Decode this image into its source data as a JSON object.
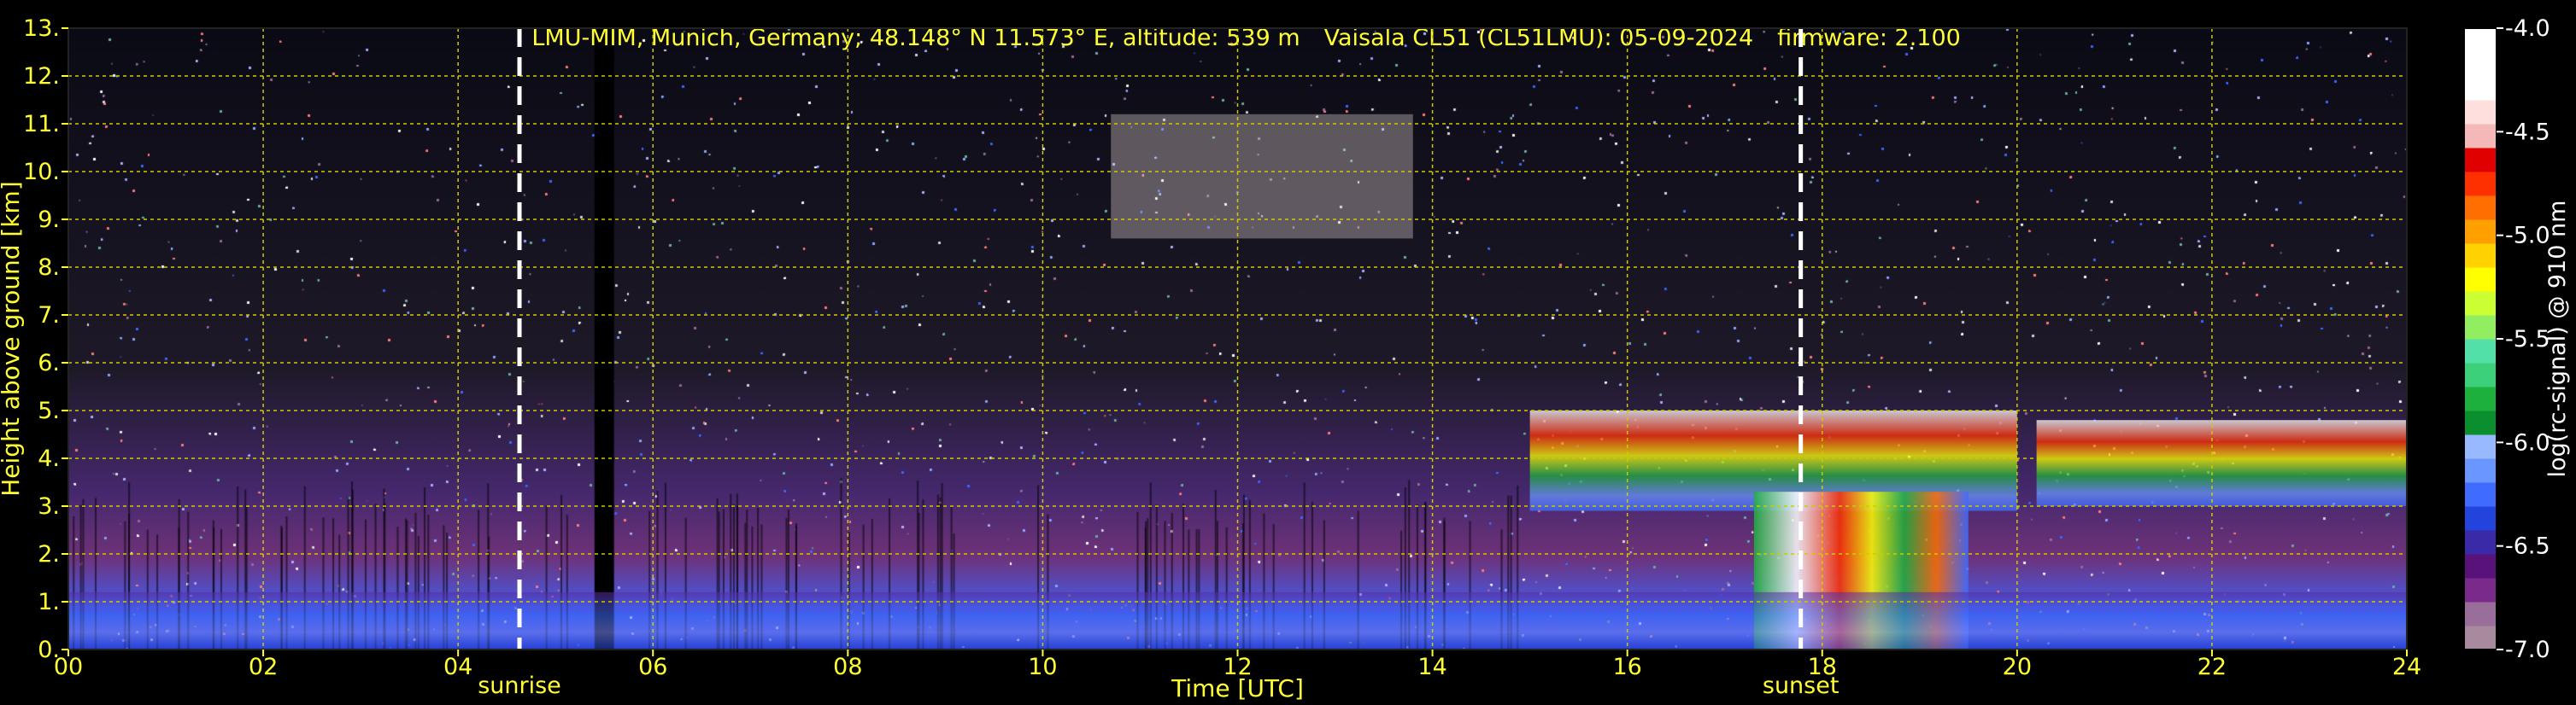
{
  "header": {
    "station": "LMU-MIM, Munich, Germany; 48.148° N 11.573° E, altitude: 539 m",
    "instrument": "Vaisala CL51 (CL51LMU): 05-09-2024",
    "firmware": "firmware: 2.100"
  },
  "colors": {
    "axis_text": "#ffff33",
    "grid": "#cccc00",
    "background": "#000000",
    "event_line": "#ffffff"
  },
  "chart_data": {
    "type": "heatmap",
    "xlabel": "Time [UTC]",
    "ylabel": "Height above ground [km]",
    "xlim": [
      0,
      24
    ],
    "ylim": [
      0,
      13
    ],
    "x_ticks": [
      "00",
      "02",
      "04",
      "06",
      "08",
      "10",
      "12",
      "14",
      "16",
      "18",
      "20",
      "22",
      "24"
    ],
    "y_ticks": [
      "0.",
      "1.",
      "2.",
      "3.",
      "4.",
      "5.",
      "6.",
      "7.",
      "8.",
      "9.",
      "10.",
      "11.",
      "12.",
      "13."
    ],
    "grid": true,
    "events": [
      {
        "label": "sunrise",
        "time": 4.63
      },
      {
        "label": "sunset",
        "time": 17.78
      }
    ],
    "data_gap": [
      5.4,
      5.6
    ],
    "colorbar": {
      "label": "log(rc-signal) @ 910 nm",
      "range": [
        -7.0,
        -4.0
      ],
      "ticks": [
        "-7.0",
        "-6.5",
        "-6.0",
        "-5.5",
        "-5.0",
        "-4.5",
        "-4.0"
      ],
      "colors": [
        "#a88a9e",
        "#9a6e9a",
        "#7a2a8a",
        "#58127a",
        "#3a2aa8",
        "#2244dd",
        "#3f6cff",
        "#6a96ff",
        "#98b8ff",
        "#0b8f2e",
        "#1eb03c",
        "#3cd07a",
        "#52e0a8",
        "#90ee60",
        "#ccff33",
        "#ffff00",
        "#ffd200",
        "#ffa000",
        "#ff6e00",
        "#ff3000",
        "#e00000",
        "#f4b8b8",
        "#ffdede",
        "#ffffff",
        "#ffffff",
        "#ffffff"
      ]
    },
    "features": [
      {
        "name": "cirrus",
        "time_range": [
          10.7,
          13.8
        ],
        "height_range": [
          8.6,
          11.2
        ]
      },
      {
        "name": "cloud-layer",
        "time_range": [
          15.0,
          20.0
        ],
        "height_range": [
          2.9,
          5.0
        ]
      },
      {
        "name": "precipitation",
        "time_range": [
          17.3,
          19.5
        ],
        "height_range": [
          0.0,
          3.3
        ]
      },
      {
        "name": "cloud-layer",
        "time_range": [
          20.2,
          24.0
        ],
        "height_range": [
          3.0,
          4.8
        ]
      },
      {
        "name": "boundary-layer",
        "time_range": [
          0,
          24
        ],
        "height_range": [
          0.0,
          1.2
        ]
      }
    ]
  }
}
